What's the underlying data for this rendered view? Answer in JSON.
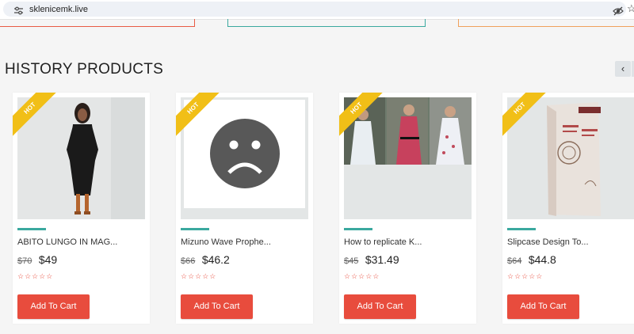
{
  "browser": {
    "url": "sklenicemk.live",
    "icons": [
      "tune-icon",
      "eye-off-icon",
      "star-icon"
    ],
    "star_glyph": "☆"
  },
  "section": {
    "title": "HISTORY PRODUCTS",
    "prev_glyph": "‹"
  },
  "products": [
    {
      "badge": "HOT",
      "name": "ABITO LUNGO IN MAG...",
      "old_price": "$70",
      "price": "$49",
      "rating": "☆☆☆☆☆",
      "button": "Add To Cart"
    },
    {
      "badge": "HOT",
      "name": "Mizuno Wave Prophe...",
      "old_price": "$66",
      "price": "$46.2",
      "rating": "☆☆☆☆☆",
      "button": "Add To Cart"
    },
    {
      "badge": "HOT",
      "name": "How to replicate K...",
      "old_price": "$45",
      "price": "$31.49",
      "rating": "☆☆☆☆☆",
      "button": "Add To Cart"
    },
    {
      "badge": "HOT",
      "name": "Slipcase Design To...",
      "old_price": "$64",
      "price": "$44.8",
      "rating": "☆☆☆☆☆",
      "button": "Add To Cart"
    }
  ],
  "colors": {
    "accent_red": "#e84c3d",
    "accent_teal": "#3aa99f",
    "hot_yellow": "#f1bf17",
    "page_bg": "#f5f5f5"
  }
}
